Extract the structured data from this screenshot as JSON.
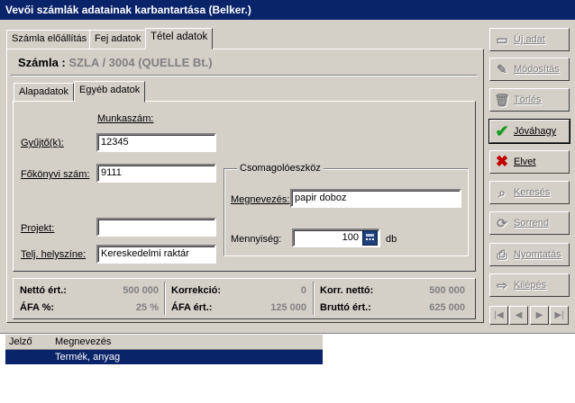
{
  "window": {
    "title": "Vevői számlák adatainak karbantartása (Belker.)"
  },
  "tabs": [
    "Számla előállítás",
    "Fej adatok",
    "Tétel adatok"
  ],
  "invoice": {
    "label": "Számla :",
    "value": "SZLA / 3004 (QUELLE Bt.)"
  },
  "subtabs": [
    "Alapadatok",
    "Egyéb adatok"
  ],
  "form": {
    "munkaszam_label": "Munkaszám:",
    "gyujto_label": "Gyűjtő(k):",
    "gyujto_value": "12345",
    "fokonyv_label": "Főkönyvi szám:",
    "fokonyv_value": "9111",
    "projekt_label": "Projekt:",
    "projekt_value": "",
    "telj_label": "Telj. helyszíne:",
    "telj_value": "Kereskedelmi raktár"
  },
  "package": {
    "title": "Csomagolóeszköz",
    "name_label": "Megnevezés:",
    "name_value": "papir doboz",
    "qty_label": "Mennyiség:",
    "qty_value": "100",
    "unit": "db"
  },
  "summary": {
    "netto_label": "Nettó ért.:",
    "netto_value": "500 000",
    "afa_pct_label": "ÁFA %:",
    "afa_pct_value": "25 %",
    "korrekcio_label": "Korrekció:",
    "korrekcio_value": "0",
    "afa_ert_label": "ÁFA ért.:",
    "afa_ert_value": "125 000",
    "korr_netto_label": "Korr. nettó:",
    "korr_netto_value": "500 000",
    "brutto_label": "Bruttó ért.:",
    "brutto_value": "625 000"
  },
  "buttons": {
    "new": "Új adat",
    "modify": "Módosítás",
    "delete": "Törlés",
    "approve": "Jóváhagy",
    "cancel": "Elvet",
    "search": "Keresés",
    "order": "Sorrend",
    "print": "Nyomtatás",
    "exit": "Kilépés"
  },
  "nav": [
    "|◀",
    "◀",
    "▶",
    "▶|"
  ],
  "list": {
    "columns": [
      "Jelző",
      "Megnevezés"
    ],
    "rows": [
      {
        "flag": "",
        "name": "Termék, anyag"
      }
    ]
  }
}
